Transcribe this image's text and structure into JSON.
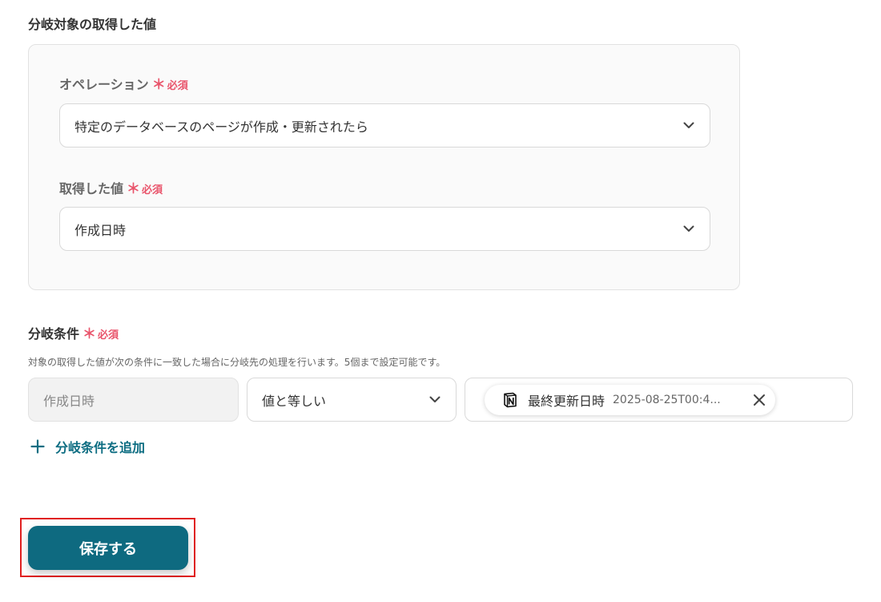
{
  "section": {
    "title": "分岐対象の取得した値"
  },
  "operation": {
    "label": "オペレーション",
    "required_mark": "＊",
    "required_text": "必須",
    "selected": "特定のデータベースのページが作成・更新されたら"
  },
  "retrieved_value": {
    "label": "取得した値",
    "required_mark": "＊",
    "required_text": "必須",
    "selected": "作成日時"
  },
  "condition": {
    "label": "分岐条件",
    "required_mark": "＊",
    "required_text": "必須",
    "description": "対象の取得した値が次の条件に一致した場合に分岐先の処理を行います。5個まで設定可能です。",
    "field_value": "作成日時",
    "operator": "値と等しい",
    "chip": {
      "icon": "notion-icon",
      "name": "最終更新日時",
      "value": "2025-08-25T00:4..."
    },
    "add_label": "分岐条件を追加"
  },
  "save": {
    "label": "保存する"
  },
  "colors": {
    "accent": "#0e6a80",
    "required": "#e9546b",
    "highlight": "#e02020"
  }
}
